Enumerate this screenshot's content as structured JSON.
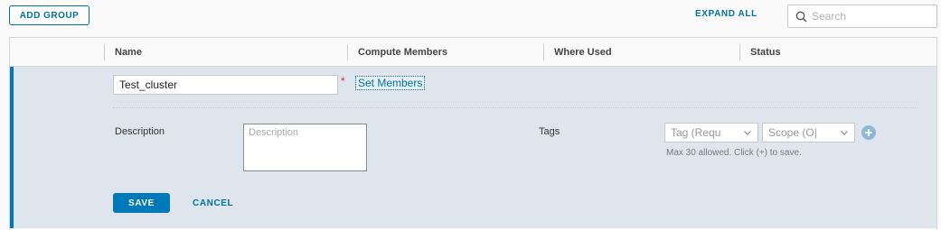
{
  "toolbar": {
    "add_group_label": "ADD GROUP",
    "expand_all_label": "EXPAND ALL",
    "search_placeholder": "Search"
  },
  "grid": {
    "columns": [
      "Name",
      "Compute Members",
      "Where Used",
      "Status"
    ]
  },
  "edit_form": {
    "name_value": "Test_cluster",
    "required_marker": "*",
    "set_members_label": "Set Members",
    "description_label": "Description",
    "description_placeholder": "Description",
    "tags_label": "Tags",
    "tag_placeholder": "Tag (Requ",
    "scope_placeholder": "Scope (O|",
    "tags_hint": "Max 30 allowed. Click (+) to save.",
    "save_label": "SAVE",
    "cancel_label": "CANCEL"
  },
  "colors": {
    "accent": "#0079b8",
    "row_bg": "#dee5ec",
    "required": "#e02b2b"
  },
  "icons": {
    "search": "search-icon",
    "chevron": "chevron-down-icon",
    "add": "add-circle-icon"
  }
}
